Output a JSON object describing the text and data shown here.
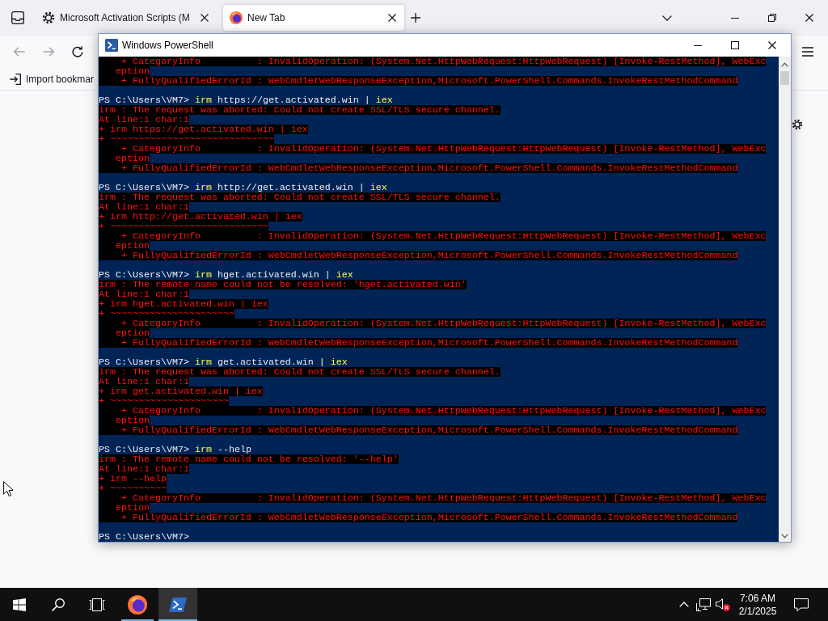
{
  "browser": {
    "tabs": [
      {
        "kind": "site",
        "title": "Microsoft Activation Scripts (M",
        "selected": false
      },
      {
        "kind": "new-tab",
        "title": "New Tab",
        "selected": true
      }
    ],
    "nav_buttons": [
      {
        "kind": "back",
        "disabled": true
      },
      {
        "kind": "forward",
        "disabled": true
      },
      {
        "kind": "reload",
        "disabled": false
      }
    ],
    "bookmarks_toolbar": {
      "import_button": "Import bookmar"
    }
  },
  "powershell": {
    "title": "Windows PowerShell",
    "blocks": [
      {
        "lines": [
          {
            "kind": "error",
            "text": "    + CategoryInfo          : InvalidOperation: (System.Net.HttpWebRequest:HttpWebRequest) [Invoke-RestMethod], WebExc"
          },
          {
            "kind": "error",
            "text": "   eption"
          },
          {
            "kind": "error",
            "text": "    + FullyQualifiedErrorId : WebCmdletWebResponseException,Microsoft.PowerShell.Commands.InvokeRestMethodCommand"
          }
        ]
      },
      {
        "lines": [
          {
            "kind": "prompt",
            "prompt": "PS C:\\Users\\VM7>",
            "command": [
              {
                "kind": "command",
                "text": "irm"
              },
              {
                "kind": "argument",
                "text": "https://get.activated.win"
              },
              {
                "kind": "operator",
                "text": "|"
              },
              {
                "kind": "command",
                "text": "iex"
              }
            ]
          },
          {
            "kind": "error",
            "text": "irm : The request was aborted: Could not create SSL/TLS secure channel."
          },
          {
            "kind": "error",
            "text": "At line:1 char:1"
          },
          {
            "kind": "error",
            "text": "+ irm https://get.activated.win | iex"
          },
          {
            "kind": "error",
            "text": "+ ~~~~~~~~~~~~~~~~~~~~~~~~~~~~~"
          },
          {
            "kind": "error",
            "text": "    + CategoryInfo          : InvalidOperation: (System.Net.HttpWebRequest:HttpWebRequest) [Invoke-RestMethod], WebExc"
          },
          {
            "kind": "error",
            "text": "   eption"
          },
          {
            "kind": "error",
            "text": "    + FullyQualifiedErrorId : WebCmdletWebResponseException,Microsoft.PowerShell.Commands.InvokeRestMethodCommand"
          }
        ]
      },
      {
        "lines": [
          {
            "kind": "prompt",
            "prompt": "PS C:\\Users\\VM7>",
            "command": [
              {
                "kind": "command",
                "text": "irm"
              },
              {
                "kind": "argument",
                "text": "http://get.activated.win"
              },
              {
                "kind": "operator",
                "text": "|"
              },
              {
                "kind": "command",
                "text": "iex"
              }
            ]
          },
          {
            "kind": "error",
            "text": "irm : The request was aborted: Could not create SSL/TLS secure channel."
          },
          {
            "kind": "error",
            "text": "At line:1 char:1"
          },
          {
            "kind": "error",
            "text": "+ irm http://get.activated.win | iex"
          },
          {
            "kind": "error",
            "text": "+ ~~~~~~~~~~~~~~~~~~~~~~~~~~~~"
          },
          {
            "kind": "error",
            "text": "    + CategoryInfo          : InvalidOperation: (System.Net.HttpWebRequest:HttpWebRequest) [Invoke-RestMethod], WebExc"
          },
          {
            "kind": "error",
            "text": "   eption"
          },
          {
            "kind": "error",
            "text": "    + FullyQualifiedErrorId : WebCmdletWebResponseException,Microsoft.PowerShell.Commands.InvokeRestMethodCommand"
          }
        ]
      },
      {
        "lines": [
          {
            "kind": "prompt",
            "prompt": "PS C:\\Users\\VM7>",
            "command": [
              {
                "kind": "command",
                "text": "irm"
              },
              {
                "kind": "argument",
                "text": "hget.activated.win"
              },
              {
                "kind": "operator",
                "text": "|"
              },
              {
                "kind": "command",
                "text": "iex"
              }
            ]
          },
          {
            "kind": "error",
            "text": "irm : The remote name could not be resolved: 'hget.activated.win'"
          },
          {
            "kind": "error",
            "text": "At line:1 char:1"
          },
          {
            "kind": "error",
            "text": "+ irm hget.activated.win | iex"
          },
          {
            "kind": "error",
            "text": "+ ~~~~~~~~~~~~~~~~~~~~~~"
          },
          {
            "kind": "error",
            "text": "    + CategoryInfo          : InvalidOperation: (System.Net.HttpWebRequest:HttpWebRequest) [Invoke-RestMethod], WebExc"
          },
          {
            "kind": "error",
            "text": "   eption"
          },
          {
            "kind": "error",
            "text": "    + FullyQualifiedErrorId : WebCmdletWebResponseException,Microsoft.PowerShell.Commands.InvokeRestMethodCommand"
          }
        ]
      },
      {
        "lines": [
          {
            "kind": "prompt",
            "prompt": "PS C:\\Users\\VM7>",
            "command": [
              {
                "kind": "command",
                "text": "irm"
              },
              {
                "kind": "argument",
                "text": "get.activated.win"
              },
              {
                "kind": "operator",
                "text": "|"
              },
              {
                "kind": "command",
                "text": "iex"
              }
            ]
          },
          {
            "kind": "error",
            "text": "irm : The request was aborted: Could not create SSL/TLS secure channel."
          },
          {
            "kind": "error",
            "text": "At line:1 char:1"
          },
          {
            "kind": "error",
            "text": "+ irm get.activated.win | iex"
          },
          {
            "kind": "error",
            "text": "+ ~~~~~~~~~~~~~~~~~~~~~"
          },
          {
            "kind": "error",
            "text": "    + CategoryInfo          : InvalidOperation: (System.Net.HttpWebRequest:HttpWebRequest) [Invoke-RestMethod], WebExc"
          },
          {
            "kind": "error",
            "text": "   eption"
          },
          {
            "kind": "error",
            "text": "    + FullyQualifiedErrorId : WebCmdletWebResponseException,Microsoft.PowerShell.Commands.InvokeRestMethodCommand"
          }
        ]
      },
      {
        "lines": [
          {
            "kind": "prompt",
            "prompt": "PS C:\\Users\\VM7>",
            "command": [
              {
                "kind": "command",
                "text": "irm"
              },
              {
                "kind": "argument",
                "text": "--help"
              }
            ]
          },
          {
            "kind": "error",
            "text": "irm : The remote name could not be resolved: '--help'"
          },
          {
            "kind": "error",
            "text": "At line:1 char:1"
          },
          {
            "kind": "error",
            "text": "+ irm --help"
          },
          {
            "kind": "error",
            "text": "+ ~~~~~~~~~~"
          },
          {
            "kind": "error",
            "text": "    + CategoryInfo          : InvalidOperation: (System.Net.HttpWebRequest:HttpWebRequest) [Invoke-RestMethod], WebExc"
          },
          {
            "kind": "error",
            "text": "   eption"
          },
          {
            "kind": "error",
            "text": "    + FullyQualifiedErrorId : WebCmdletWebResponseException,Microsoft.PowerShell.Commands.InvokeRestMethodCommand"
          }
        ]
      },
      {
        "lines": [
          {
            "kind": "prompt",
            "prompt": "PS C:\\Users\\VM7>"
          }
        ]
      }
    ]
  },
  "taskbar": {
    "apps": [
      {
        "kind": "browser",
        "selected": false
      },
      {
        "kind": "terminal",
        "selected": true
      }
    ],
    "clock": {
      "time": "7:06 AM",
      "date": "2/1/2025"
    }
  }
}
